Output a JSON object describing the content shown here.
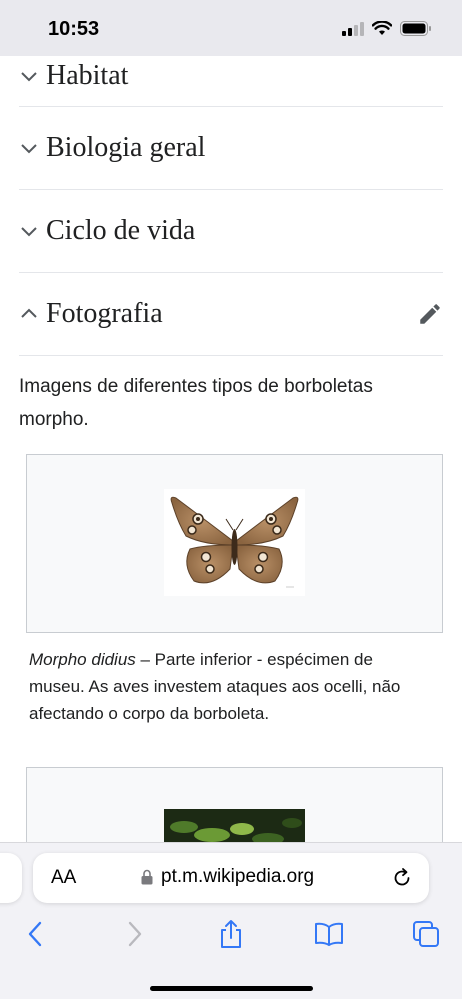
{
  "status": {
    "time": "10:53"
  },
  "sections": [
    {
      "title": "Habitat",
      "expanded": false
    },
    {
      "title": "Biologia geral",
      "expanded": false
    },
    {
      "title": "Ciclo de vida",
      "expanded": false
    },
    {
      "title": "Fotografia",
      "expanded": true
    }
  ],
  "intro_text": "Imagens de diferentes tipos de borboletas morpho.",
  "figures": [
    {
      "caption_species": "Morpho didius",
      "caption_rest": " – Parte inferior - espécimen de museu. As aves investem ataques aos ocelli, não afectando o corpo da borboleta."
    }
  ],
  "browser": {
    "text_size_label": "AA",
    "url": "pt.m.wikipedia.org"
  },
  "icons": {
    "collapsed": "chevron-down-icon",
    "expanded": "chevron-up-icon",
    "edit": "pencil-icon",
    "lock": "lock-icon",
    "reload": "reload-icon",
    "back": "back-arrow-icon",
    "forward": "forward-arrow-icon",
    "share": "share-icon",
    "bookmarks": "bookmarks-icon",
    "tabs": "tabs-icon"
  },
  "colors": {
    "accent": "#3478f6",
    "text": "#202122",
    "border": "#c8ccd1"
  }
}
